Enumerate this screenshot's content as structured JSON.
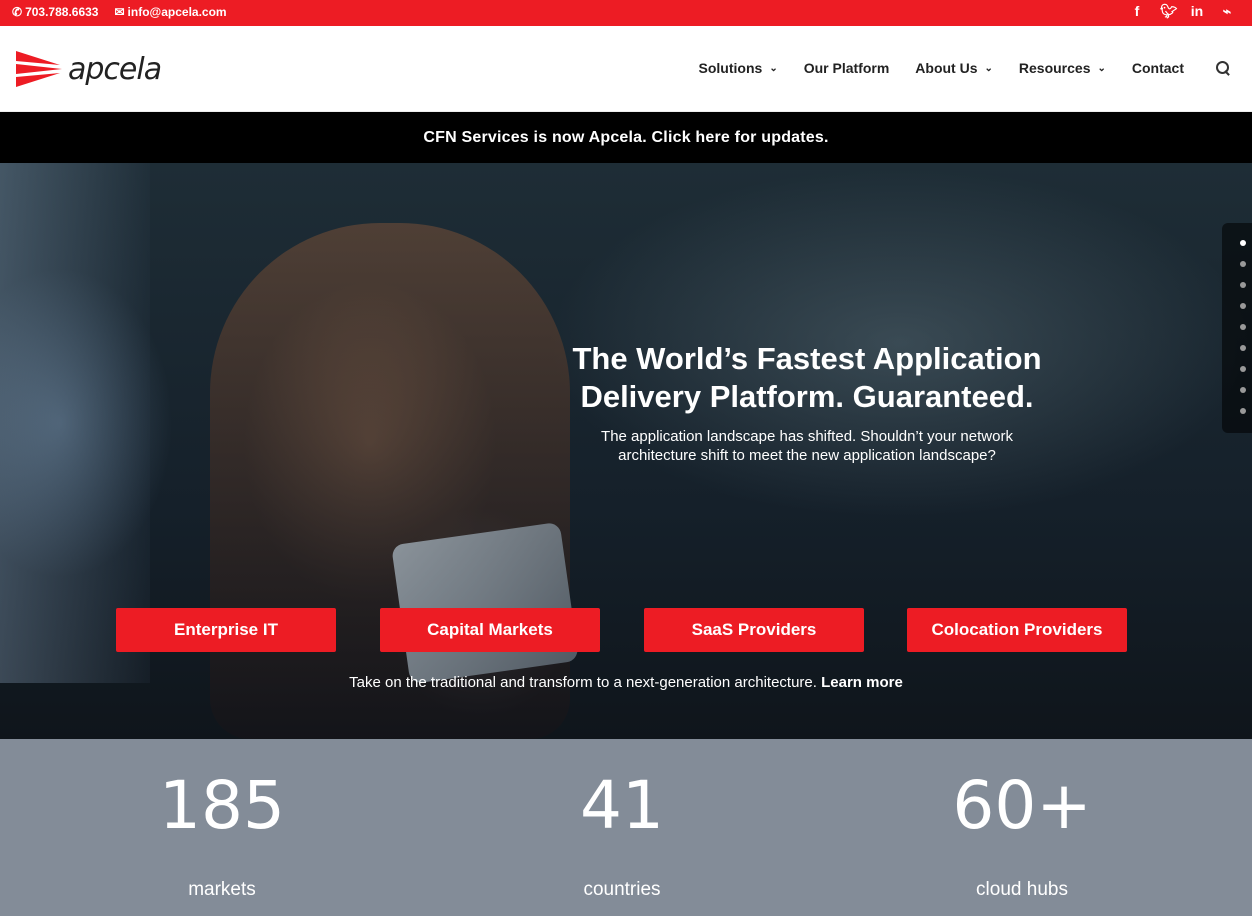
{
  "topbar": {
    "phone": "703.788.6633",
    "email": "info@apcela.com",
    "social": [
      "facebook-icon",
      "twitter-icon",
      "linkedin-icon",
      "rss-icon"
    ]
  },
  "header": {
    "logo_text": "apcela",
    "nav": [
      {
        "label": "Solutions",
        "dropdown": true
      },
      {
        "label": "Our Platform",
        "dropdown": false
      },
      {
        "label": "About Us",
        "dropdown": true
      },
      {
        "label": "Resources",
        "dropdown": true
      },
      {
        "label": "Contact",
        "dropdown": false
      }
    ]
  },
  "announcement": "CFN Services is now Apcela. Click here for updates.",
  "hero": {
    "title": "The World’s Fastest Application Delivery Platform. Guaranteed.",
    "subtitle": "The application landscape has shifted. Shouldn’t your network architecture shift to meet the new application landscape?",
    "buttons": [
      "Enterprise IT",
      "Capital Markets",
      "SaaS Providers",
      "Colocation Providers"
    ],
    "footer_text": "Take on the traditional and transform to a next-generation architecture.",
    "footer_link": "Learn more",
    "slide_count": 9,
    "active_slide": 1
  },
  "stats": [
    {
      "number": "185",
      "label": "markets"
    },
    {
      "number": "41",
      "label": "countries"
    },
    {
      "number": "60+",
      "label": "cloud hubs"
    }
  ],
  "colors": {
    "brand_red": "#ed1c24",
    "stats_bg": "#838c98"
  }
}
